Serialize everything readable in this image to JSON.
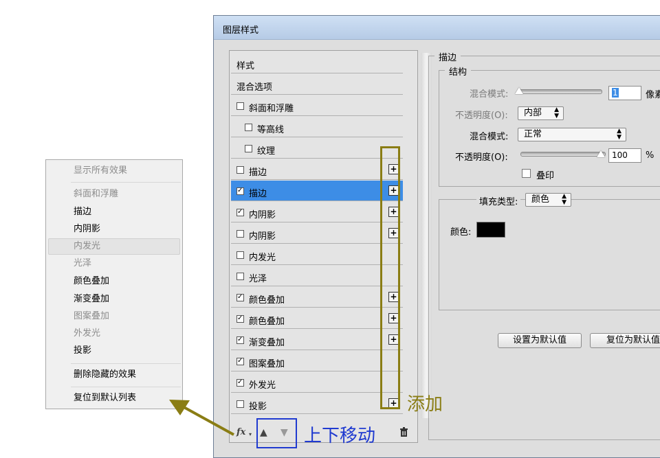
{
  "context_menu": {
    "show_all": "显示所有效果",
    "items": [
      {
        "label": "斜面和浮雕",
        "disabled": true
      },
      {
        "label": "描边",
        "disabled": false
      },
      {
        "label": "内阴影",
        "disabled": false
      },
      {
        "label": "内发光",
        "disabled": true
      },
      {
        "label": "光泽",
        "disabled": true
      },
      {
        "label": "颜色叠加",
        "disabled": false
      },
      {
        "label": "渐变叠加",
        "disabled": false
      },
      {
        "label": "图案叠加",
        "disabled": true
      },
      {
        "label": "外发光",
        "disabled": true
      },
      {
        "label": "投影",
        "disabled": false
      }
    ],
    "delete_hidden": "删除隐藏的效果",
    "reset_list": "复位到默认列表"
  },
  "dialog": {
    "title": "图层样式",
    "style_list": [
      {
        "label": "样式",
        "checkbox": false,
        "checked": false,
        "plus": false,
        "indent": 0,
        "selected": false
      },
      {
        "label": "混合选项",
        "checkbox": false,
        "checked": false,
        "plus": false,
        "indent": 0,
        "selected": false
      },
      {
        "label": "斜面和浮雕",
        "checkbox": true,
        "checked": false,
        "plus": false,
        "indent": 0,
        "selected": false
      },
      {
        "label": "等高线",
        "checkbox": true,
        "checked": false,
        "plus": false,
        "indent": 1,
        "selected": false
      },
      {
        "label": "纹理",
        "checkbox": true,
        "checked": false,
        "plus": false,
        "indent": 1,
        "selected": false
      },
      {
        "label": "描边",
        "checkbox": true,
        "checked": false,
        "plus": true,
        "indent": 0,
        "selected": false
      },
      {
        "label": "描边",
        "checkbox": true,
        "checked": true,
        "plus": true,
        "indent": 0,
        "selected": true
      },
      {
        "label": "内阴影",
        "checkbox": true,
        "checked": true,
        "plus": true,
        "indent": 0,
        "selected": false
      },
      {
        "label": "内阴影",
        "checkbox": true,
        "checked": false,
        "plus": true,
        "indent": 0,
        "selected": false
      },
      {
        "label": "内发光",
        "checkbox": true,
        "checked": false,
        "plus": false,
        "indent": 0,
        "selected": false
      },
      {
        "label": "光泽",
        "checkbox": true,
        "checked": false,
        "plus": false,
        "indent": 0,
        "selected": false
      },
      {
        "label": "颜色叠加",
        "checkbox": true,
        "checked": true,
        "plus": true,
        "indent": 0,
        "selected": false
      },
      {
        "label": "颜色叠加",
        "checkbox": true,
        "checked": true,
        "plus": true,
        "indent": 0,
        "selected": false
      },
      {
        "label": "渐变叠加",
        "checkbox": true,
        "checked": true,
        "plus": true,
        "indent": 0,
        "selected": false
      },
      {
        "label": "图案叠加",
        "checkbox": true,
        "checked": true,
        "plus": false,
        "indent": 0,
        "selected": false
      },
      {
        "label": "外发光",
        "checkbox": true,
        "checked": true,
        "plus": false,
        "indent": 0,
        "selected": false
      },
      {
        "label": "投影",
        "checkbox": true,
        "checked": false,
        "plus": true,
        "indent": 0,
        "selected": false
      }
    ],
    "bottom_bar": {
      "fx": "fx",
      "up_icon": "arrow-up-icon",
      "down_icon": "arrow-down-icon",
      "trash_icon": "trash-icon"
    },
    "stroke": {
      "section_title": "描边",
      "structure_title": "结构",
      "blend_mode_label_dim": "混合模式:",
      "blend_value": "1",
      "px_unit": "像素",
      "opacity_label_dim": "不透明度(O):",
      "position_value": "内部",
      "blend_mode_label": "混合模式:",
      "blend_mode_value": "正常",
      "opacity_label": "不透明度(O):",
      "opacity_value": "100",
      "percent": "%",
      "overprint_label": "叠印",
      "fill_type_label": "填充类型:",
      "fill_type_value": "颜色",
      "color_label": "颜色:",
      "color_swatch": "#000000",
      "set_default_button": "设置为默认值",
      "reset_default_button": "复位为默认值"
    }
  },
  "annotations": {
    "add_label": "添加",
    "move_label": "上下移动",
    "add_color": "#8a7d14",
    "move_color": "#1f3ad0"
  }
}
